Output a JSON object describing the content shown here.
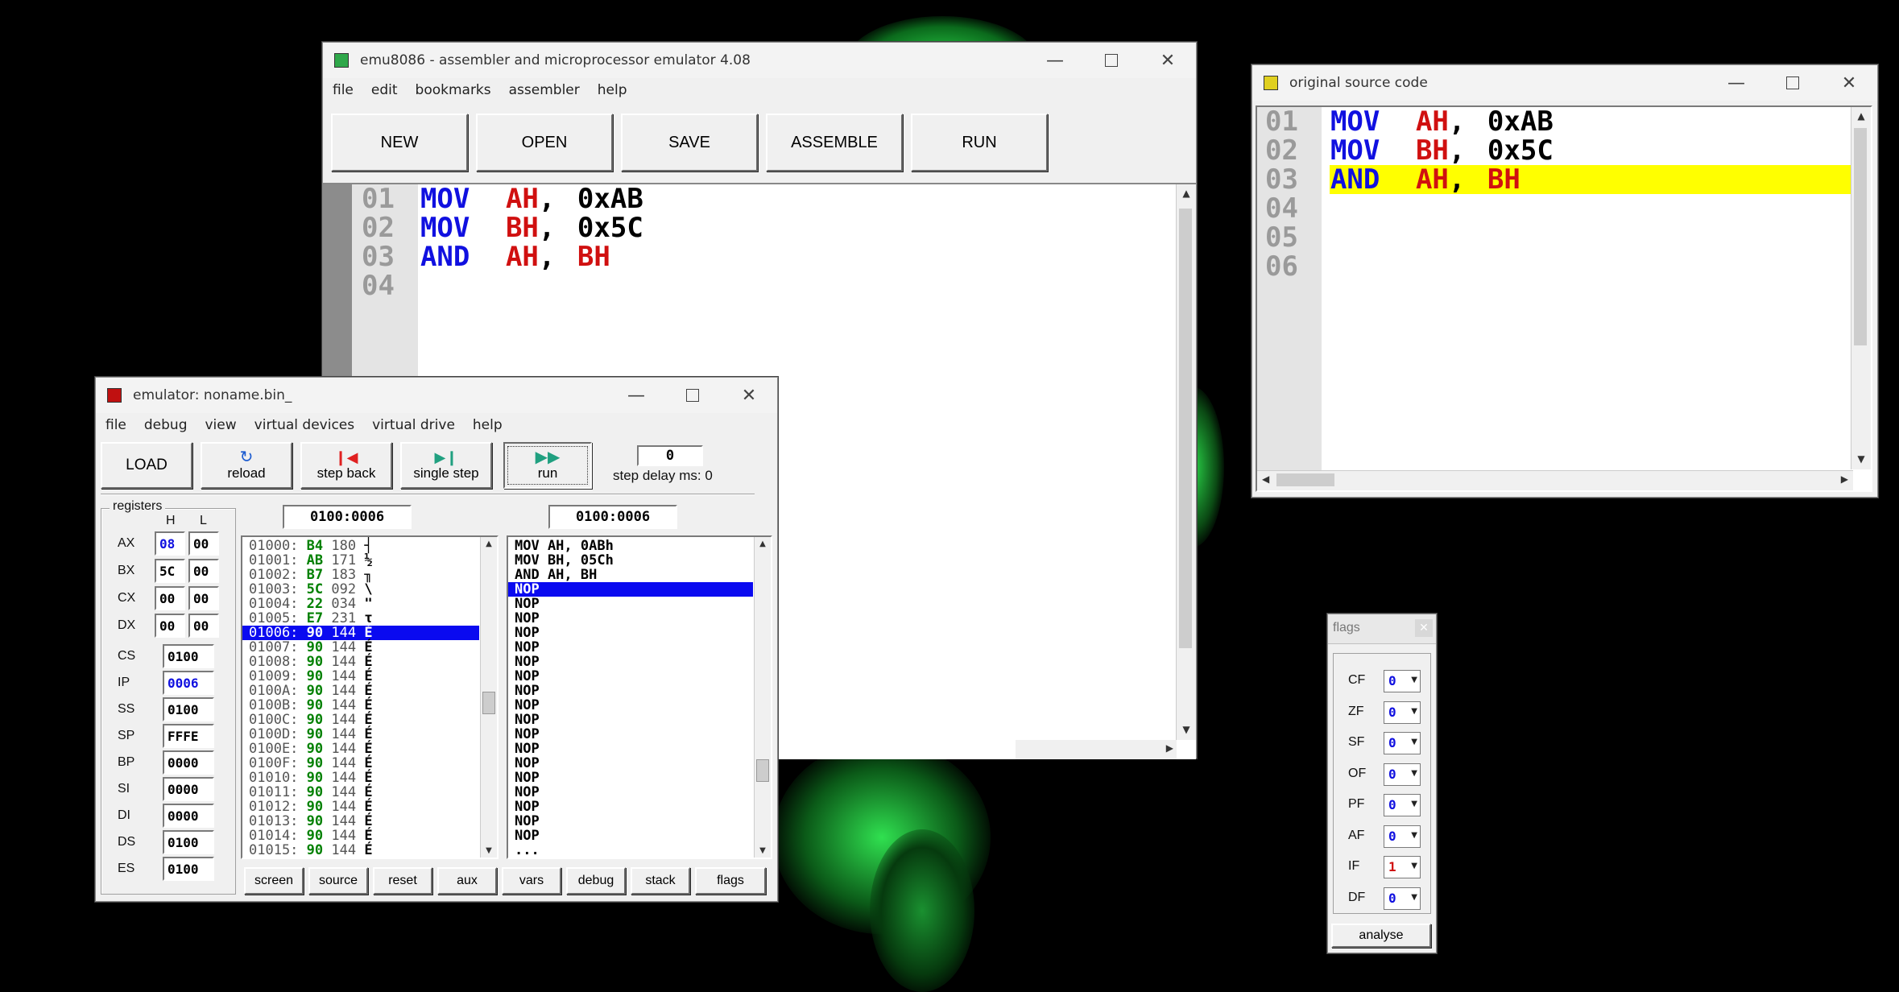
{
  "editor": {
    "title": "emu8086 - assembler and microprocessor emulator 4.08",
    "menu": [
      "file",
      "edit",
      "bookmarks",
      "assembler",
      "help"
    ],
    "toolbar": {
      "new": "NEW",
      "open": "OPEN",
      "save": "SAVE",
      "assemble": "ASSEMBLE",
      "run": "RUN"
    },
    "lines": [
      {
        "num": "01",
        "op": "MOV",
        "reg": "AH",
        "sep": ",",
        "arg": "0xAB",
        "arg_is_reg": false
      },
      {
        "num": "02",
        "op": "MOV",
        "reg": "BH",
        "sep": ",",
        "arg": "0x5C",
        "arg_is_reg": false
      },
      {
        "num": "03",
        "op": "AND",
        "reg": "AH",
        "sep": ",",
        "arg": "BH",
        "arg_is_reg": true
      },
      {
        "num": "04",
        "op": "",
        "reg": "",
        "sep": "",
        "arg": "",
        "arg_is_reg": false
      }
    ]
  },
  "source": {
    "title": "original source code",
    "highlight_color": "#ffff00",
    "lines": [
      {
        "num": "01",
        "op": "MOV",
        "reg": "AH",
        "sep": ",",
        "arg": "0xAB",
        "arg_is_reg": false
      },
      {
        "num": "02",
        "op": "MOV",
        "reg": "BH",
        "sep": ",",
        "arg": "0x5C",
        "arg_is_reg": false
      },
      {
        "num": "03",
        "op": "AND",
        "reg": "AH",
        "sep": ",",
        "arg": "BH",
        "arg_is_reg": true
      },
      {
        "num": "04",
        "op": "",
        "reg": "",
        "sep": "",
        "arg": "",
        "arg_is_reg": false
      },
      {
        "num": "05",
        "op": "",
        "reg": "",
        "sep": "",
        "arg": "",
        "arg_is_reg": false
      },
      {
        "num": "06",
        "op": "",
        "reg": "",
        "sep": "",
        "arg": "",
        "arg_is_reg": false
      }
    ]
  },
  "emulator": {
    "title": "emulator: noname.bin_",
    "menu": [
      "file",
      "debug",
      "view",
      "virtual devices",
      "virtual drive",
      "help"
    ],
    "toolbar": {
      "load": "LOAD",
      "reload": "reload",
      "step_back": "step back",
      "single_step": "single step",
      "run": "run",
      "step_delay_value": "0",
      "step_delay_label": "step delay ms: 0"
    },
    "registers_label": "registers",
    "hl_labels": {
      "h": "H",
      "l": "L"
    },
    "regs8": [
      {
        "name": "AX",
        "h": "08",
        "l": "00",
        "h_changed": true
      },
      {
        "name": "BX",
        "h": "5C",
        "l": "00",
        "h_changed": false
      },
      {
        "name": "CX",
        "h": "00",
        "l": "00",
        "h_changed": false
      },
      {
        "name": "DX",
        "h": "00",
        "l": "00",
        "h_changed": false
      }
    ],
    "regs16": [
      {
        "name": "CS",
        "value": "0100",
        "changed": false
      },
      {
        "name": "IP",
        "value": "0006",
        "changed": true
      },
      {
        "name": "SS",
        "value": "0100",
        "changed": false
      },
      {
        "name": "SP",
        "value": "FFFE",
        "changed": false
      },
      {
        "name": "BP",
        "value": "0000",
        "changed": false
      },
      {
        "name": "SI",
        "value": "0000",
        "changed": false
      },
      {
        "name": "DI",
        "value": "0000",
        "changed": false
      },
      {
        "name": "DS",
        "value": "0100",
        "changed": false
      },
      {
        "name": "ES",
        "value": "0100",
        "changed": false
      }
    ],
    "mem_address": "0100:0006",
    "dis_address": "0100:0006",
    "memory": [
      {
        "addr": "01000:",
        "hex": "B4",
        "dec": "180",
        "ch": "┤",
        "sel": false
      },
      {
        "addr": "01001:",
        "hex": "AB",
        "dec": "171",
        "ch": "½",
        "sel": false
      },
      {
        "addr": "01002:",
        "hex": "B7",
        "dec": "183",
        "ch": "╖",
        "sel": false
      },
      {
        "addr": "01003:",
        "hex": "5C",
        "dec": "092",
        "ch": "\\",
        "sel": false
      },
      {
        "addr": "01004:",
        "hex": "22",
        "dec": "034",
        "ch": "\"",
        "sel": false
      },
      {
        "addr": "01005:",
        "hex": "E7",
        "dec": "231",
        "ch": "τ",
        "sel": false
      },
      {
        "addr": "01006:",
        "hex": "90",
        "dec": "144",
        "ch": "É",
        "sel": true
      },
      {
        "addr": "01007:",
        "hex": "90",
        "dec": "144",
        "ch": "É",
        "sel": false
      },
      {
        "addr": "01008:",
        "hex": "90",
        "dec": "144",
        "ch": "É",
        "sel": false
      },
      {
        "addr": "01009:",
        "hex": "90",
        "dec": "144",
        "ch": "É",
        "sel": false
      },
      {
        "addr": "0100A:",
        "hex": "90",
        "dec": "144",
        "ch": "É",
        "sel": false
      },
      {
        "addr": "0100B:",
        "hex": "90",
        "dec": "144",
        "ch": "É",
        "sel": false
      },
      {
        "addr": "0100C:",
        "hex": "90",
        "dec": "144",
        "ch": "É",
        "sel": false
      },
      {
        "addr": "0100D:",
        "hex": "90",
        "dec": "144",
        "ch": "É",
        "sel": false
      },
      {
        "addr": "0100E:",
        "hex": "90",
        "dec": "144",
        "ch": "É",
        "sel": false
      },
      {
        "addr": "0100F:",
        "hex": "90",
        "dec": "144",
        "ch": "É",
        "sel": false
      },
      {
        "addr": "01010:",
        "hex": "90",
        "dec": "144",
        "ch": "É",
        "sel": false
      },
      {
        "addr": "01011:",
        "hex": "90",
        "dec": "144",
        "ch": "É",
        "sel": false
      },
      {
        "addr": "01012:",
        "hex": "90",
        "dec": "144",
        "ch": "É",
        "sel": false
      },
      {
        "addr": "01013:",
        "hex": "90",
        "dec": "144",
        "ch": "É",
        "sel": false
      },
      {
        "addr": "01014:",
        "hex": "90",
        "dec": "144",
        "ch": "É",
        "sel": false
      },
      {
        "addr": "01015:",
        "hex": "90",
        "dec": "144",
        "ch": "É",
        "sel": false
      }
    ],
    "disasm": [
      {
        "text": "MOV AH, 0ABh",
        "sel": false
      },
      {
        "text": "MOV BH, 05Ch",
        "sel": false
      },
      {
        "text": "AND AH, BH",
        "sel": false
      },
      {
        "text": "NOP",
        "sel": true
      },
      {
        "text": "NOP",
        "sel": false
      },
      {
        "text": "NOP",
        "sel": false
      },
      {
        "text": "NOP",
        "sel": false
      },
      {
        "text": "NOP",
        "sel": false
      },
      {
        "text": "NOP",
        "sel": false
      },
      {
        "text": "NOP",
        "sel": false
      },
      {
        "text": "NOP",
        "sel": false
      },
      {
        "text": "NOP",
        "sel": false
      },
      {
        "text": "NOP",
        "sel": false
      },
      {
        "text": "NOP",
        "sel": false
      },
      {
        "text": "NOP",
        "sel": false
      },
      {
        "text": "NOP",
        "sel": false
      },
      {
        "text": "NOP",
        "sel": false
      },
      {
        "text": "NOP",
        "sel": false
      },
      {
        "text": "NOP",
        "sel": false
      },
      {
        "text": "NOP",
        "sel": false
      },
      {
        "text": "NOP",
        "sel": false
      },
      {
        "text": "...",
        "sel": false
      }
    ],
    "bottom_buttons": [
      "screen",
      "source",
      "reset",
      "aux",
      "vars",
      "debug",
      "stack",
      "flags"
    ]
  },
  "flags": {
    "title": "flags",
    "items": [
      {
        "name": "CF",
        "value": "0"
      },
      {
        "name": "ZF",
        "value": "0"
      },
      {
        "name": "SF",
        "value": "0"
      },
      {
        "name": "OF",
        "value": "0"
      },
      {
        "name": "PF",
        "value": "0"
      },
      {
        "name": "AF",
        "value": "0"
      },
      {
        "name": "IF",
        "value": "1"
      },
      {
        "name": "DF",
        "value": "0"
      }
    ],
    "analyse": "analyse"
  },
  "colors": {
    "keyword": "#1010e0",
    "register": "#d01010",
    "line_number": "#9a9a9a",
    "selection": "#0a0af0",
    "mem_hex": "#008000"
  }
}
